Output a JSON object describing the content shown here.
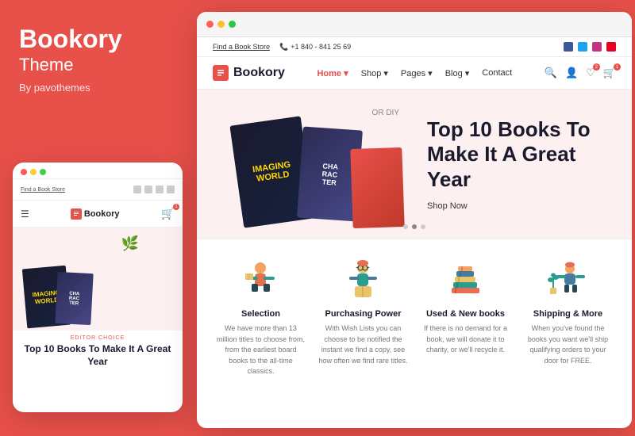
{
  "left": {
    "title": "Bookory",
    "subtitle": "Theme",
    "by": "By pavothemes"
  },
  "mobile": {
    "find_store": "Find a Book Store",
    "logo_text": "Bookory",
    "editor_choice": "EDITOR CHOICE",
    "hero_heading": "Top 10 Books To Make It A Great Year"
  },
  "browser": {
    "top_bar": {
      "find_store": "Find a Book Store",
      "phone": "+1 840 - 841 25 69"
    },
    "nav": {
      "logo": "Bookory",
      "items": [
        {
          "label": "Home",
          "active": true,
          "has_arrow": true
        },
        {
          "label": "Shop",
          "active": false,
          "has_arrow": true
        },
        {
          "label": "Pages",
          "active": false,
          "has_arrow": true
        },
        {
          "label": "Blog",
          "active": false,
          "has_arrow": true
        },
        {
          "label": "Contact",
          "active": false,
          "has_arrow": false
        }
      ]
    },
    "hero": {
      "heading": "Top 10 Books To Make It A Great Year",
      "shop_now": "Shop Now",
      "plant_label": "OR DIY"
    },
    "features": [
      {
        "id": "selection",
        "title": "Selection",
        "desc": "We have more than 13 million titles to choose from, from the earliest board books to the all-time classics."
      },
      {
        "id": "purchasing-power",
        "title": "Purchasing Power",
        "desc": "With Wish Lists you can choose to be notified the instant we find a copy, see how often we find rare titles."
      },
      {
        "id": "used-new-books",
        "title": "Used & New books",
        "desc": "If there is no demand for a book, we will donate it to charity, or we'll recycle it."
      },
      {
        "id": "shipping-more",
        "title": "Shipping & More",
        "desc": "When you've found the books you want we'll ship qualifying orders to your door for FREE."
      }
    ]
  }
}
